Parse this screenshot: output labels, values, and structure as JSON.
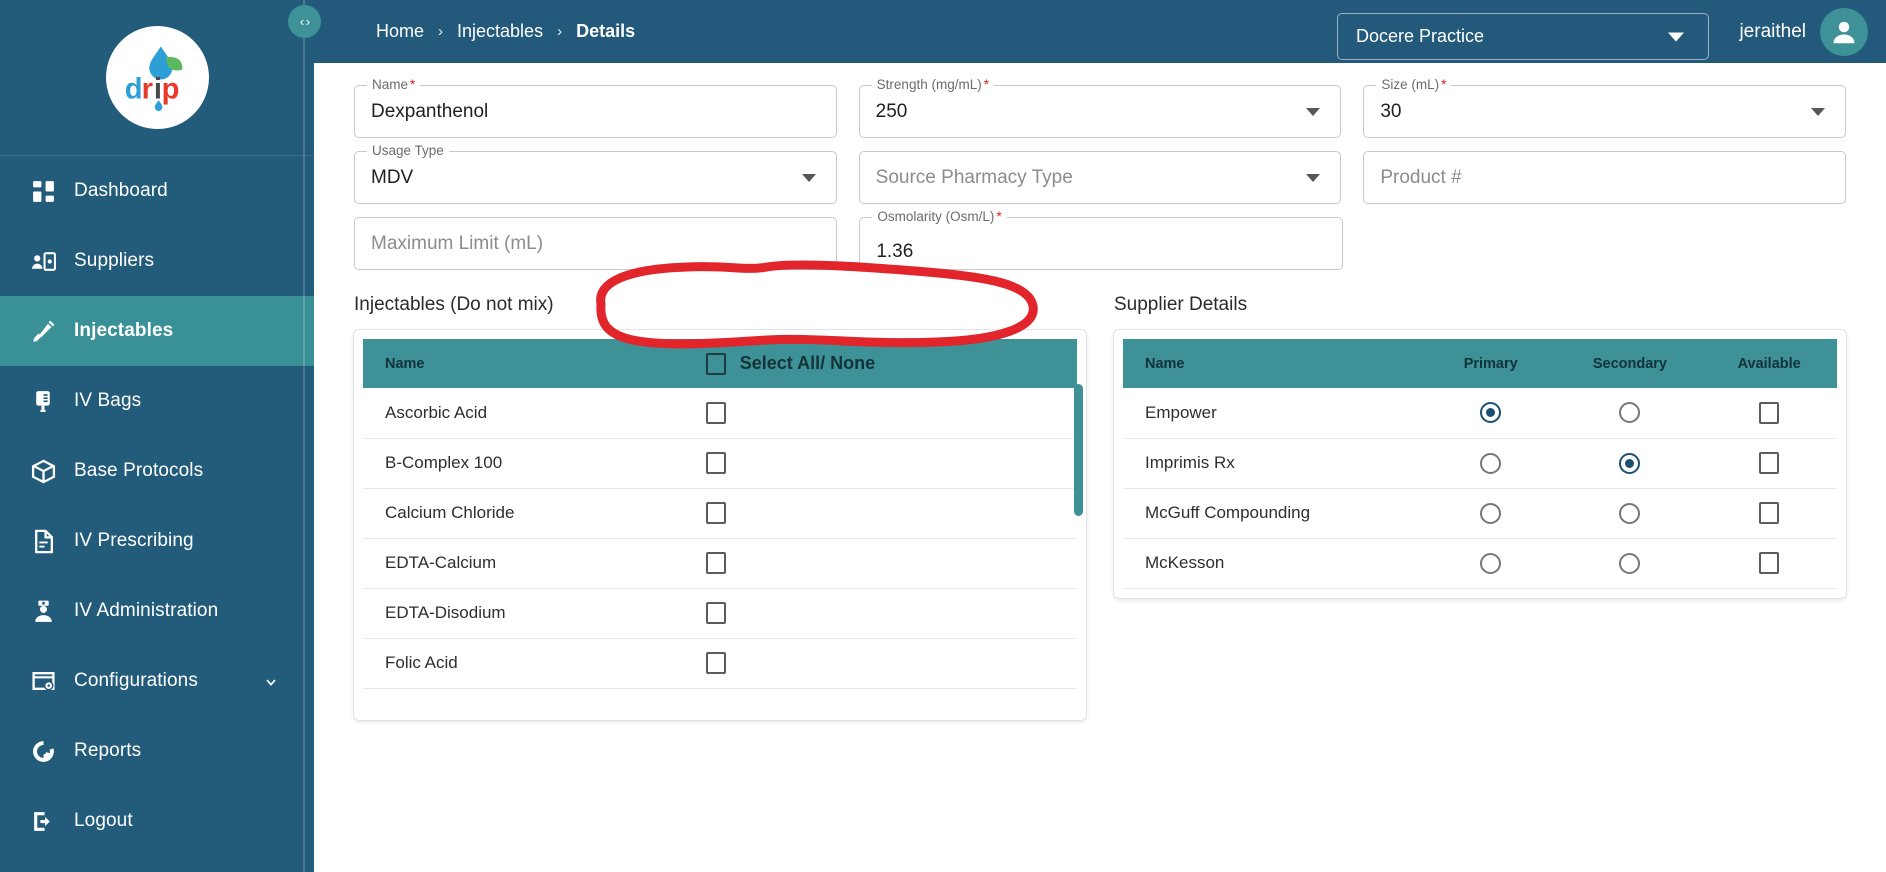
{
  "brand": {
    "logo_text": "drip",
    "accent_teal": "#3d9197",
    "dark_blue": "#23597A",
    "annotation_red": "#e1252b"
  },
  "sidebar": {
    "collapse_toggle": "‹ ›",
    "items": [
      {
        "label": "Dashboard",
        "icon": "dashboard-icon",
        "active": false
      },
      {
        "label": "Suppliers",
        "icon": "suppliers-icon",
        "active": false
      },
      {
        "label": "Injectables",
        "icon": "syringe-icon",
        "active": true
      },
      {
        "label": "IV Bags",
        "icon": "iv-bag-icon",
        "active": false
      },
      {
        "label": "Base Protocols",
        "icon": "cube-icon",
        "active": false
      },
      {
        "label": "IV Prescribing",
        "icon": "document-icon",
        "active": false
      },
      {
        "label": "IV Administration",
        "icon": "nurse-icon",
        "active": false
      },
      {
        "label": "Configurations",
        "icon": "settings-window-icon",
        "active": false,
        "expandable": true
      },
      {
        "label": "Reports",
        "icon": "donut-chart-icon",
        "active": false
      },
      {
        "label": "Logout",
        "icon": "logout-icon",
        "active": false
      }
    ]
  },
  "header": {
    "breadcrumb": [
      {
        "label": "Home",
        "current": false
      },
      {
        "label": "Injectables",
        "current": false
      },
      {
        "label": "Details",
        "current": true
      }
    ],
    "separator": "›",
    "practice_select": {
      "value": "Docere Practice"
    },
    "user_name": "jeraithel"
  },
  "form": {
    "name": {
      "legend": "Name",
      "required": true,
      "value": "Dexpanthenol"
    },
    "strength": {
      "legend": "Strength (mg/mL)",
      "required": true,
      "value": "250"
    },
    "size": {
      "legend": "Size (mL)",
      "required": true,
      "value": "30"
    },
    "usage_type": {
      "legend": "Usage Type",
      "required": false,
      "value": "MDV"
    },
    "source_pharmacy_type": {
      "placeholder": "Source Pharmacy Type",
      "value": ""
    },
    "product_number": {
      "placeholder": "Product #",
      "value": ""
    },
    "maximum_limit": {
      "placeholder": "Maximum Limit (mL)",
      "value": ""
    },
    "osmolarity": {
      "legend": "Osmolarity (Osm/L)",
      "required": true,
      "value": "1.36"
    }
  },
  "injectables_panel": {
    "title": "Injectables (Do not mix)",
    "columns": {
      "name": "Name",
      "select_all": "Select All/ None"
    },
    "rows": [
      {
        "name": "Ascorbic Acid",
        "checked": false
      },
      {
        "name": "B-Complex 100",
        "checked": false
      },
      {
        "name": "Calcium Chloride",
        "checked": false
      },
      {
        "name": "EDTA-Calcium",
        "checked": false
      },
      {
        "name": "EDTA-Disodium",
        "checked": false
      },
      {
        "name": "Folic Acid",
        "checked": false
      }
    ],
    "select_all_checked": false
  },
  "supplier_panel": {
    "title": "Supplier Details",
    "columns": [
      "Name",
      "Primary",
      "Secondary",
      "Available"
    ],
    "rows": [
      {
        "name": "Empower",
        "primary": true,
        "secondary": false,
        "available": false
      },
      {
        "name": "Imprimis Rx",
        "primary": false,
        "secondary": true,
        "available": false
      },
      {
        "name": "McGuff Compounding",
        "primary": false,
        "secondary": false,
        "available": false
      },
      {
        "name": "McKesson",
        "primary": false,
        "secondary": false,
        "available": false
      }
    ]
  },
  "annotation": {
    "shape": "red-hand-drawn-ellipse",
    "target": "maximum-limit-field"
  }
}
